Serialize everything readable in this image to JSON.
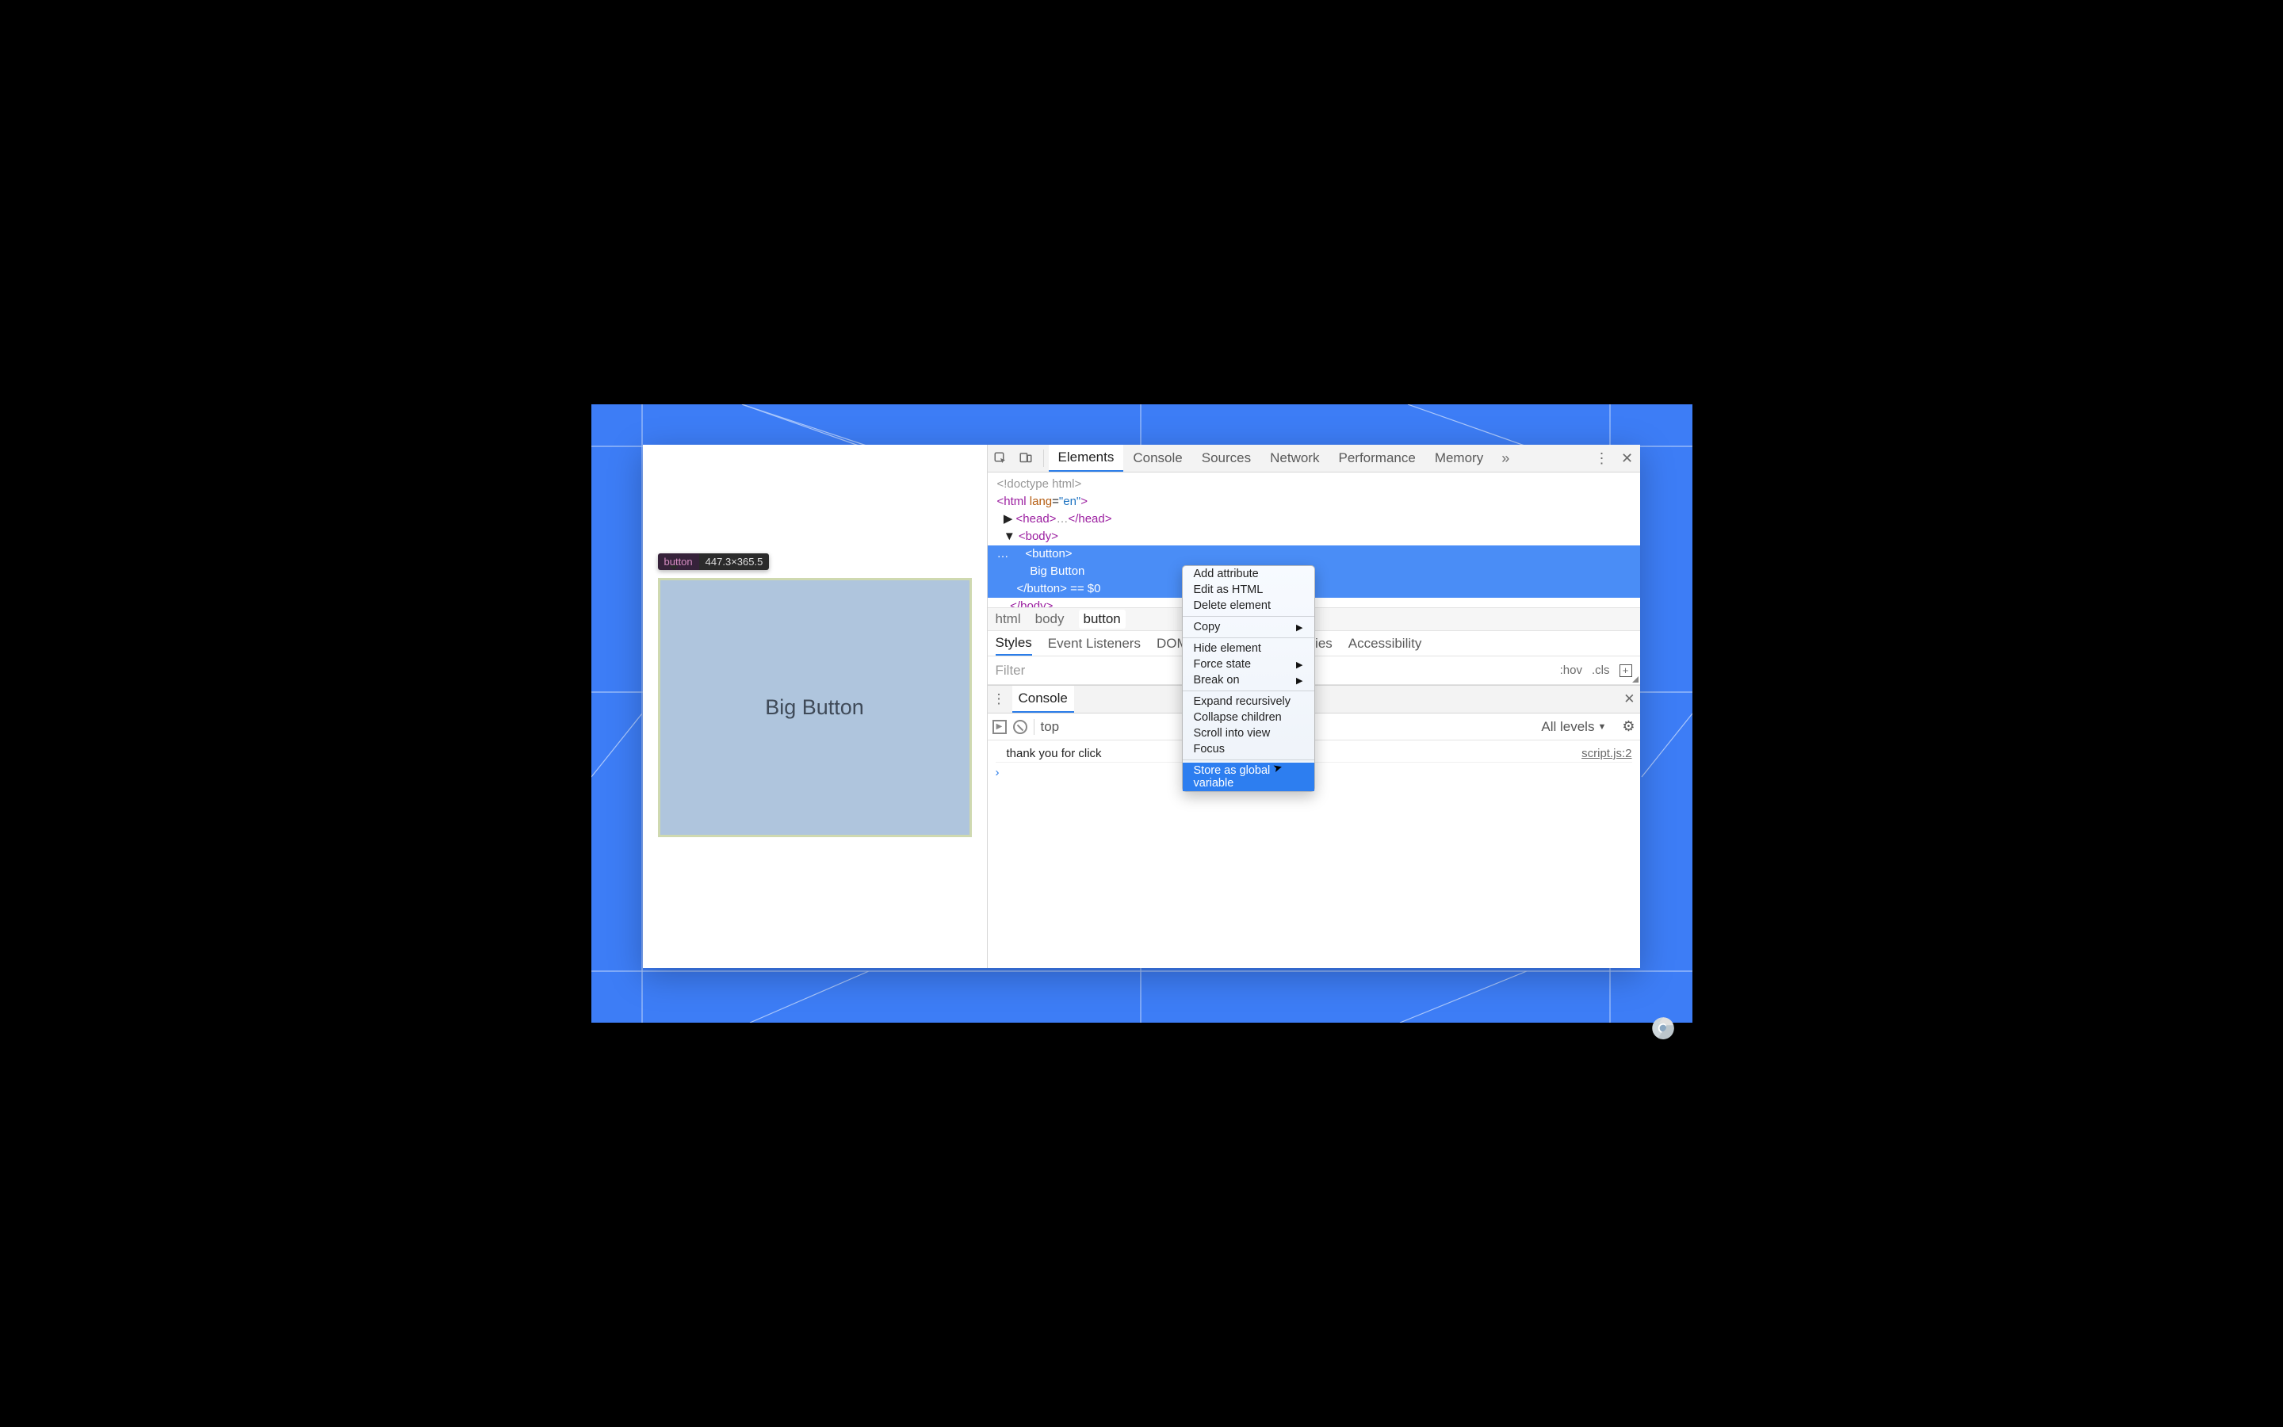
{
  "page": {
    "button_label": "Big Button",
    "tooltip_tag": "button",
    "tooltip_dims": "447.3×365.5"
  },
  "devtools": {
    "tabs": [
      "Elements",
      "Console",
      "Sources",
      "Network",
      "Performance",
      "Memory"
    ],
    "active_tab": "Elements",
    "dom": {
      "doctype": "<!doctype html>",
      "html_open": "<html lang=\"en\">",
      "head_collapsed": "<head>…</head>",
      "body_open": "<body>",
      "button_open": "<button>",
      "button_text": "Big Button",
      "button_close": "</button>",
      "eq_suffix": " == $0",
      "body_close": "</body>"
    },
    "breadcrumbs": [
      "html",
      "body",
      "button"
    ],
    "subtabs": [
      "Styles",
      "Event Listeners",
      "DOM Breakpoints",
      "Properties",
      "Accessibility"
    ],
    "active_subtab": "Styles",
    "filter_placeholder": "Filter",
    "hov": ":hov",
    "cls": ".cls"
  },
  "context_menu": {
    "groups": [
      [
        "Add attribute",
        "Edit as HTML",
        "Delete element"
      ],
      [
        {
          "label": "Copy",
          "sub": true
        }
      ],
      [
        "Hide element",
        {
          "label": "Force state",
          "sub": true
        },
        {
          "label": "Break on",
          "sub": true
        }
      ],
      [
        "Expand recursively",
        "Collapse children",
        "Scroll into view",
        "Focus"
      ],
      [
        "Store as global variable"
      ]
    ],
    "highlighted": "Store as global variable"
  },
  "console": {
    "drawer_label": "Console",
    "context": "top",
    "levels": "All levels",
    "log_msg": "thank you for click",
    "log_src": "script.js:2"
  }
}
